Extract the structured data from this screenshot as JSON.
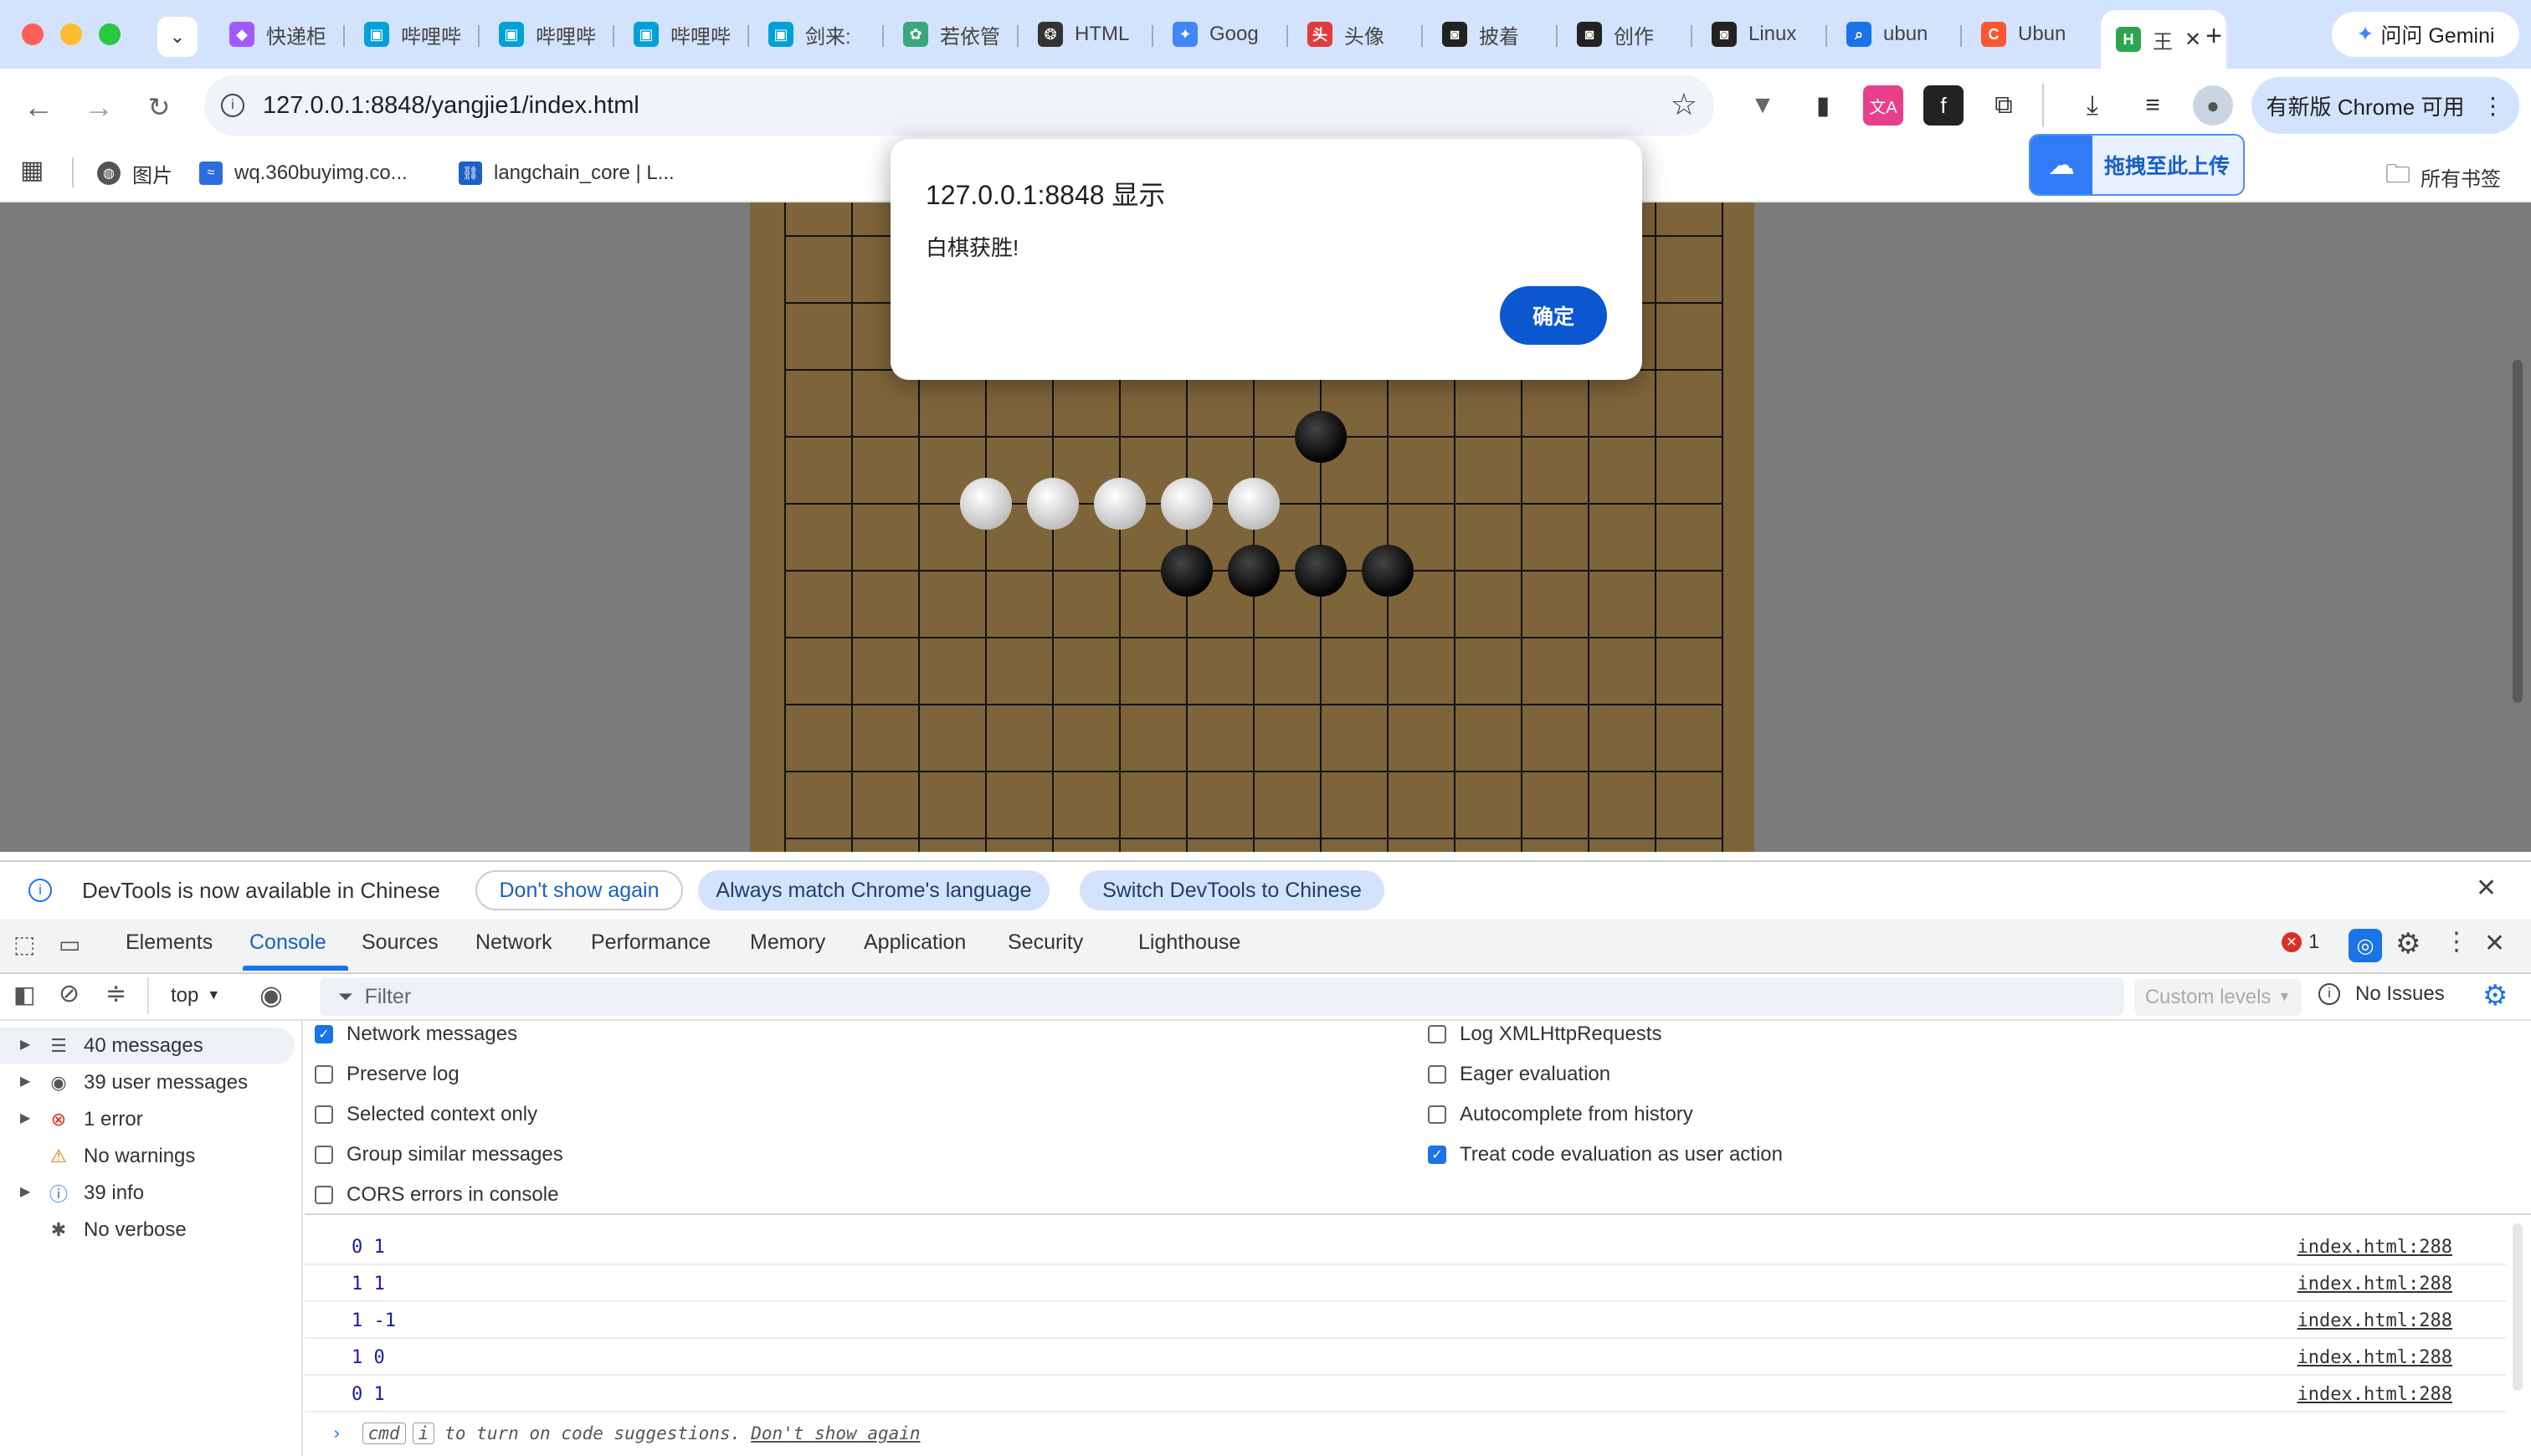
{
  "tabs": [
    {
      "label": "快递柜",
      "icon": "figma-icon",
      "color": "#a259ff"
    },
    {
      "label": "哔哩哔",
      "icon": "bilibili-icon",
      "color": "#00a1d6"
    },
    {
      "label": "哔哩哔",
      "icon": "bilibili-icon",
      "color": "#00a1d6"
    },
    {
      "label": "哔哩哔",
      "icon": "bilibili-icon",
      "color": "#00a1d6"
    },
    {
      "label": "剑来:",
      "icon": "bilibili-icon",
      "color": "#00a1d6"
    },
    {
      "label": "若依管",
      "icon": "ruoyi-icon",
      "color": "#3aa67d"
    },
    {
      "label": "HTML",
      "icon": "openai-icon",
      "color": "#333333"
    },
    {
      "label": "Goog",
      "icon": "gemini-icon",
      "color": "#4285f4"
    },
    {
      "label": "头像",
      "icon": "toutiao-icon",
      "color": "#e33b3b"
    },
    {
      "label": "披着",
      "icon": "robot-icon",
      "color": "#222222"
    },
    {
      "label": "创作",
      "icon": "robot-icon",
      "color": "#222222"
    },
    {
      "label": "Linux",
      "icon": "robot-icon",
      "color": "#222222"
    },
    {
      "label": "ubun",
      "icon": "search-icon",
      "color": "#1a73e8"
    },
    {
      "label": "Ubun",
      "icon": "csdn-icon",
      "color": "#fc5531"
    },
    {
      "label": "王",
      "icon": "hbuilder-icon",
      "color": "#2ea44f"
    }
  ],
  "gemini_button": "问问 Gemini",
  "address_bar": {
    "url": "127.0.0.1:8848/yangjie1/index.html"
  },
  "update_button": "有新版 Chrome 可用",
  "bookmarks": [
    {
      "label": "图片"
    },
    {
      "label": "wq.360buyimg.co..."
    },
    {
      "label": "langchain_core | L..."
    }
  ],
  "all_bookmarks": "所有书签",
  "baidu_upload": "拖拽至此上传",
  "alert": {
    "title": "127.0.0.1:8848 显示",
    "message": "白棋获胜!",
    "ok": "确定"
  },
  "board": {
    "white_stones": [
      [
        3,
        5
      ],
      [
        4,
        5
      ],
      [
        5,
        5
      ],
      [
        6,
        5
      ],
      [
        7,
        5
      ]
    ],
    "black_stones": [
      [
        8,
        4
      ],
      [
        6,
        6
      ],
      [
        7,
        6
      ],
      [
        8,
        6
      ],
      [
        9,
        6
      ]
    ]
  },
  "devtools": {
    "banner_text": "DevTools is now available in Chinese",
    "banner_buttons": [
      "Don't show again",
      "Always match Chrome's language",
      "Switch DevTools to Chinese"
    ],
    "tabs": [
      "Elements",
      "Console",
      "Sources",
      "Network",
      "Performance",
      "Memory",
      "Application",
      "Security",
      "Lighthouse"
    ],
    "active_tab": "Console",
    "error_count": "1",
    "context": "top",
    "filter_placeholder": "Filter",
    "levels": "Custom levels",
    "issues": "No Issues",
    "sidebar": [
      {
        "label": "40 messages",
        "icon": "list-icon"
      },
      {
        "label": "39 user messages",
        "icon": "user-icon"
      },
      {
        "label": "1 error",
        "icon": "error-icon"
      },
      {
        "label": "No warnings",
        "icon": "warning-icon"
      },
      {
        "label": "39 info",
        "icon": "info-icon"
      },
      {
        "label": "No verbose",
        "icon": "bug-icon"
      }
    ],
    "options_left": [
      {
        "label": "Network messages",
        "checked": true
      },
      {
        "label": "Preserve log",
        "checked": false
      },
      {
        "label": "Selected context only",
        "checked": false
      },
      {
        "label": "Group similar messages",
        "checked": false
      },
      {
        "label": "CORS errors in console",
        "checked": false
      }
    ],
    "options_right": [
      {
        "label": "Log XMLHttpRequests",
        "checked": false
      },
      {
        "label": "Eager evaluation",
        "checked": false
      },
      {
        "label": "Autocomplete from history",
        "checked": false
      },
      {
        "label": "Treat code evaluation as user action",
        "checked": true
      }
    ],
    "logs": [
      {
        "text": "0 1",
        "source": "index.html:288"
      },
      {
        "text": "1 1",
        "source": "index.html:288"
      },
      {
        "text": "1 -1",
        "source": "index.html:288"
      },
      {
        "text": "1 0",
        "source": "index.html:288"
      },
      {
        "text": "0 1",
        "source": "index.html:288"
      }
    ],
    "hint": {
      "key1": "cmd",
      "key2": "i",
      "text": "to turn on code suggestions.",
      "link": "Don't show again"
    }
  }
}
